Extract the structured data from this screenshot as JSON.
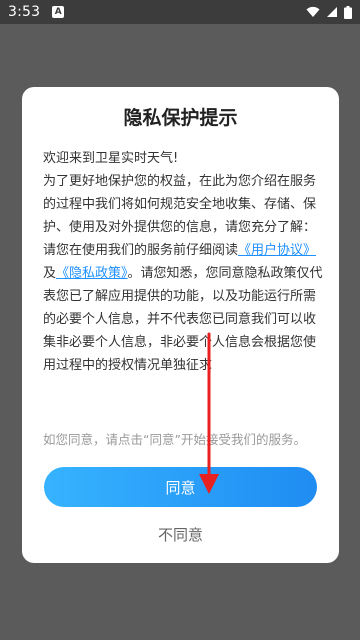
{
  "status_bar": {
    "time": "3:53",
    "notification_icon_letter": "A"
  },
  "dialog": {
    "title": "隐私保护提示",
    "greeting": "欢迎来到卫星实时天气!",
    "intro": "为了更好地保护您的权益，在此为您介绍在服务的过程中我们将如何规范安全地收集、存储、保护、使用及对外提供您的信息，请您充分了解：",
    "read_prefix": "请您在使用我们的服务前仔细阅读",
    "user_agreement_link": "《用户协议》",
    "and_text": "及",
    "privacy_policy_link": "《隐私政策》",
    "read_suffix": "。请您知悉，您同意隐私政策仅代表您已了解应用提供的功能，以及功能运行所需的必要个人信息，并不代表您已同意我们可以收集非必要个人信息，非必要个人信息会根据您使用过程中的授权情况单独征求",
    "hint": "如您同意，请点击“同意”开始接受我们的服务。",
    "agree_label": "同意",
    "disagree_label": "不同意"
  },
  "colors": {
    "overlay": "#5b5b5b",
    "link": "#1e90ff",
    "agree_gradient_start": "#36b3ff",
    "agree_gradient_end": "#1f8cf2",
    "annotation_arrow": "#e8201f"
  },
  "icons": {
    "status_right": [
      "wifi-icon",
      "signal-icon",
      "battery-icon"
    ]
  }
}
